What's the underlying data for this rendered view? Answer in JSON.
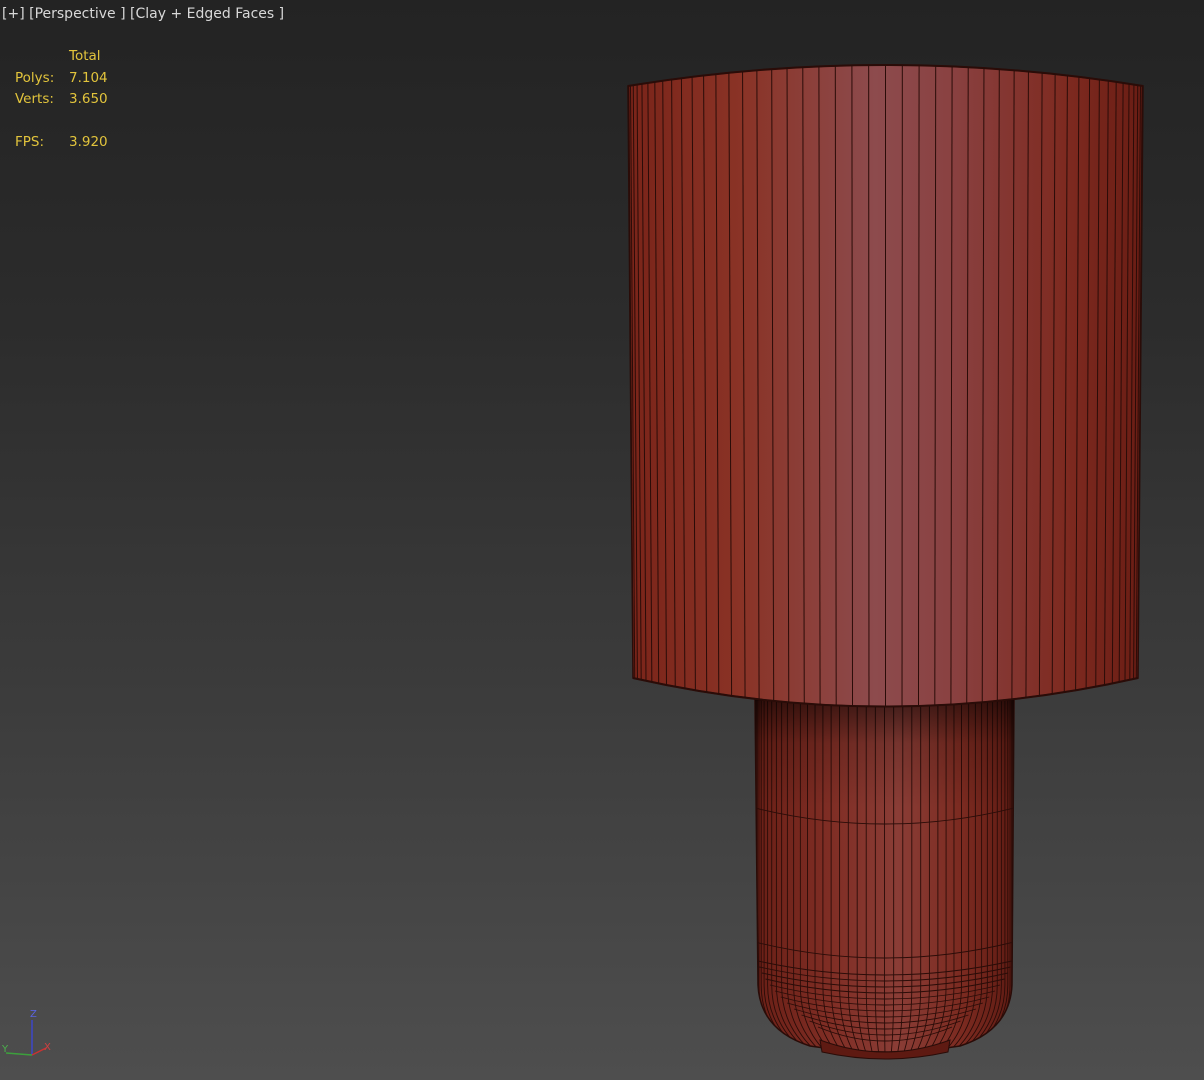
{
  "viewport": {
    "label_plus": "[+]",
    "label_view": "[Perspective ]",
    "label_shading": "[Clay + Edged Faces ]"
  },
  "stats": {
    "header": "Total",
    "polys_label": "Polys:",
    "polys_value": "7.104",
    "verts_label": "Verts:",
    "verts_value": "3.650",
    "fps_label": "FPS:",
    "fps_value": "3.920"
  },
  "axis_gizmo": {
    "x": "X",
    "y": "Y",
    "z": "Z"
  },
  "colors": {
    "stats_text": "#e2c43c",
    "label_text": "#d8d8d8",
    "clay_light": "#8a4a4c",
    "clay_dark": "#6e1f16",
    "edge": "#2a0c08",
    "axis_x": "#c83232",
    "axis_y": "#3ca03c",
    "axis_z": "#3c46c8"
  }
}
